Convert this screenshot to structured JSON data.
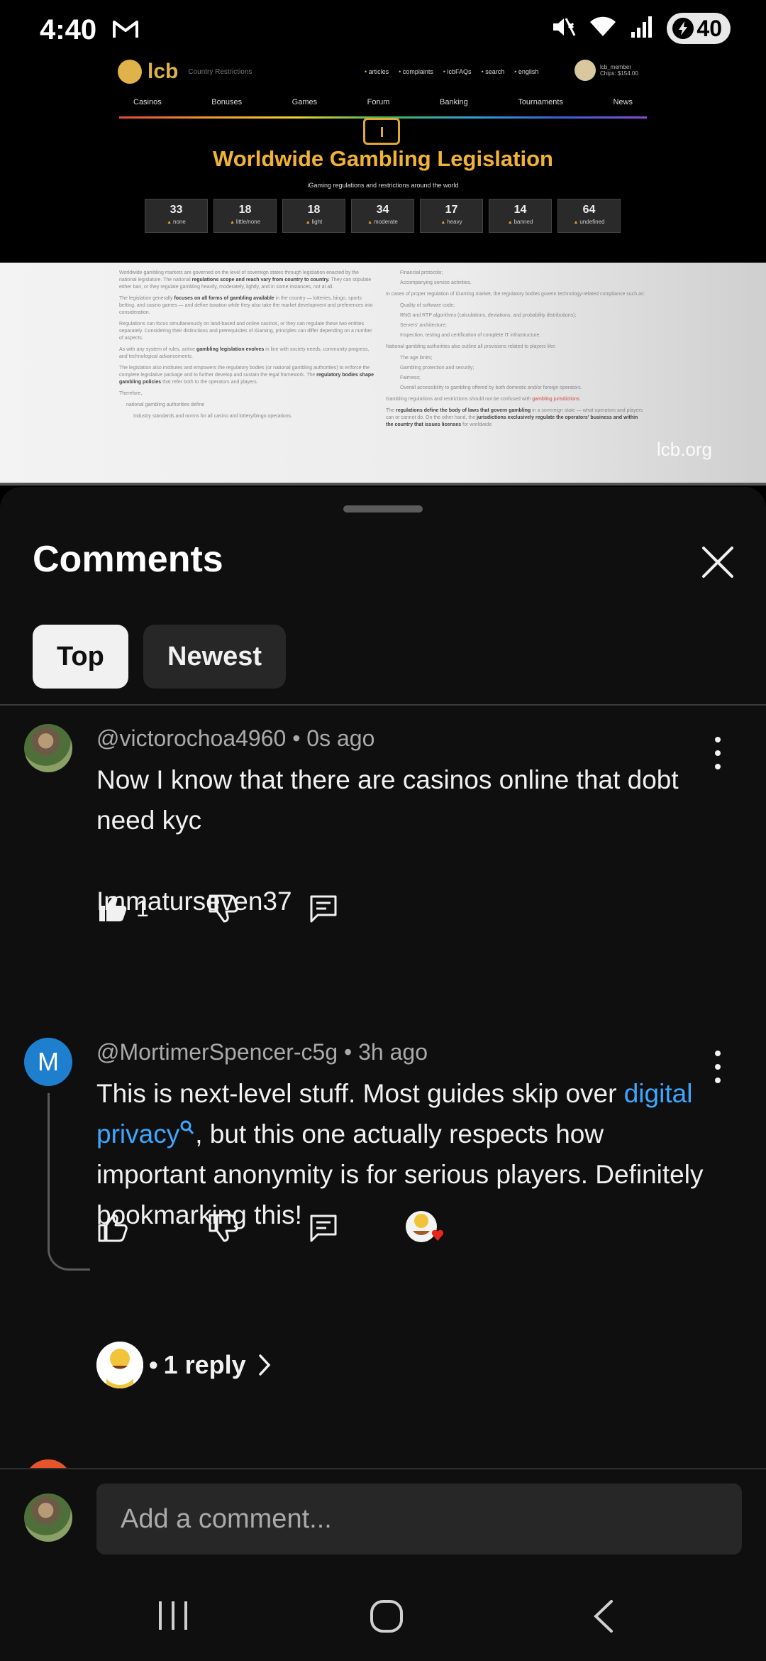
{
  "status_bar": {
    "time": "4:40",
    "battery": "40"
  },
  "video": {
    "site_logo": "lcb",
    "site_logo_sub": "Country Restrictions",
    "top_links": [
      "articles",
      "complaints",
      "lcbFAQs",
      "search",
      "english"
    ],
    "user_name": "lcb_member",
    "user_chips": "Chips: $154.00",
    "nav_items": [
      "Casinos",
      "Bonuses",
      "Games",
      "Forum",
      "Banking",
      "Tournaments",
      "News"
    ],
    "title": "Worldwide Gambling Legislation",
    "subtitle": "iGaming regulations and restrictions around the world",
    "stats": [
      {
        "value": "33",
        "label": "none"
      },
      {
        "value": "18",
        "label": "little/none"
      },
      {
        "value": "18",
        "label": "light"
      },
      {
        "value": "34",
        "label": "moderate"
      },
      {
        "value": "17",
        "label": "heavy"
      },
      {
        "value": "14",
        "label": "banned"
      },
      {
        "value": "64",
        "label": "undefined"
      }
    ],
    "doc_left_p1": "Worldwide gambling markets are governed on the level of sovereign states through legislation enacted by the national legislature. The national",
    "doc_left_p1_bold": "regulations scope and reach vary from country to country.",
    "doc_left_p1_tail": "They can stipulate either ban, or they regulate gambling heavily, moderately, lightly, and in some instances, not at all.",
    "doc_left_p2": "The legislation generally",
    "doc_left_p2_bold": "focuses on all forms of gambling available",
    "doc_left_p2_tail": "in the country — lotteries, bingo, sports betting, and casino games — and define taxation while they also take the market development and preferences into consideration.",
    "doc_left_p3": "Regulations can focus simultaneously on land-based and online casinos, or they can regulate these two entities separately. Considering their distinctions and prerequisites of iGaming, principles can differ depending on a number of aspects.",
    "doc_left_p4": "As with any system of rules, active",
    "doc_left_p4_bold": "gambling legislation evolves",
    "doc_left_p4_tail": "in line with society needs, community progress, and technological advancements.",
    "doc_left_p5": "The legislation also institutes and empowers the regulatory bodies (or national gambling authorities) to enforce the complete legislative package and to further develop and sustain the legal framework. The",
    "doc_left_p5_bold": "regulatory bodies shape gambling policies",
    "doc_left_p5_tail": "that refer both to the operators and players.",
    "doc_left_p6": "Therefore,",
    "doc_left_p7": "national gambling authorities define",
    "doc_left_p8": "Industry standards and norms for all casino and lottery/bingo operations.",
    "doc_right_lines": [
      "Financial protocols;",
      "Accompanying service activities.",
      "In cases of proper regulation of iGaming market, the regulatory bodies govern technology-related compliance such as:",
      "Quality of software code;",
      "RNG and RTP algorithms (calculations, deviations, and probability distributions);",
      "Servers' architecture;",
      "Inspection, testing and certification of complete IT infrastructure.",
      "National gambling authorities also outline all provisions related to players like:",
      "The age limits;",
      "Gambling protection and security;",
      "Fairness;",
      "Overall accessibility to gambling offered by both domestic and/or foreign operators."
    ],
    "doc_right_hl_pre": "Gambling regulations and restrictions should not be confused with",
    "doc_right_hl": "gambling jurisdictions",
    "doc_right_last_pre": "The",
    "doc_right_last_bold": "regulations define the body of laws that govern gambling",
    "doc_right_last_mid": "in a sovereign state — what operators and players can or cannot do. On the other hand, the",
    "doc_right_last_bold2": "jurisdictions exclusively regulate the operators' business and within the country that issues licenses",
    "doc_right_last_tail": "for worldwide",
    "watermark": "lcb.org"
  },
  "comments_panel": {
    "title": "Comments",
    "tabs": [
      "Top",
      "Newest"
    ],
    "comments": [
      {
        "author": "@victorochoa4960",
        "time": "0s ago",
        "lines": [
          "Now I know that there are casinos online that dobt need kyc",
          "",
          "Immaturseven37"
        ],
        "likes": "1"
      },
      {
        "avatar_letter": "M",
        "author": "@MortimerSpencer-c5g",
        "time": "3h ago",
        "text_before": "This is next-level stuff. Most guides skip over",
        "link": "digital privacy",
        "text_after": ", but this one actually respects how important anonymity is for serious players. Definitely bookmarking this!",
        "likes": "",
        "replies": "1 reply"
      }
    ],
    "composer_placeholder": "Add a comment..."
  },
  "colors": {
    "panel_bg": "#0f0f0f",
    "chip_active_bg": "#f1f1f1",
    "chip_bg": "#272727",
    "link": "#3ea6ff",
    "meta_text": "#aaaaaa",
    "avatar_m": "#1f7fcf",
    "site_gold": "#f2b233"
  },
  "icons": [
    "gmail-icon",
    "mute-icon",
    "wifi-icon",
    "signal-icon",
    "battery-icon",
    "close-icon",
    "more-vert-icon",
    "thumb-up-icon",
    "thumb-down-icon",
    "reply-icon",
    "creator-heart-icon",
    "chevron-right-icon",
    "recents-icon",
    "home-icon",
    "back-icon",
    "search-icon"
  ]
}
